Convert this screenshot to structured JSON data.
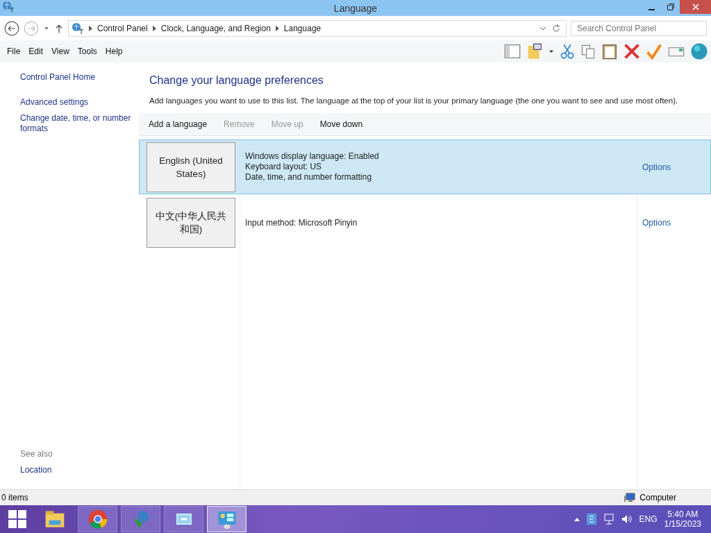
{
  "window": {
    "title": "Language"
  },
  "address": {
    "crumbs": [
      "Control Panel",
      "Clock, Language, and Region",
      "Language"
    ]
  },
  "search": {
    "placeholder": "Search Control Panel"
  },
  "menu": [
    "File",
    "Edit",
    "View",
    "Tools",
    "Help"
  ],
  "sidebar": {
    "items": [
      "Control Panel Home",
      "Advanced settings",
      "Change date, time, or number formats"
    ],
    "see_also": "See also",
    "see_also_items": [
      "Location"
    ]
  },
  "heading": "Change your language preferences",
  "description": "Add languages you want to use to this list. The language at the top of your list is your primary language (the one you want to see and use most often).",
  "commands": [
    {
      "label": "Add a language",
      "disabled": false
    },
    {
      "label": "Remove",
      "disabled": true
    },
    {
      "label": "Move up",
      "disabled": true
    },
    {
      "label": "Move down",
      "disabled": false
    }
  ],
  "languages": [
    {
      "name": "English (United States)",
      "details": [
        "Windows display language: Enabled",
        "Keyboard layout: US",
        "Date, time, and number formatting"
      ],
      "options": "Options",
      "selected": true
    },
    {
      "name": "中文(中华人民共和国)",
      "details": [
        "Input method: Microsoft Pinyin"
      ],
      "options": "Options",
      "selected": false
    }
  ],
  "status_bar": {
    "items": "0 items",
    "location": "Computer"
  },
  "taskbar": {
    "apps": [
      {
        "kind": "explorer",
        "running": false,
        "active": false
      },
      {
        "kind": "chrome",
        "running": true,
        "active": false
      },
      {
        "kind": "download",
        "running": true,
        "active": false
      },
      {
        "kind": "window",
        "running": true,
        "active": false
      },
      {
        "kind": "panel",
        "running": true,
        "active": true
      }
    ],
    "language": "ENG",
    "time": "5:40 AM",
    "date": "1/15/2023"
  }
}
